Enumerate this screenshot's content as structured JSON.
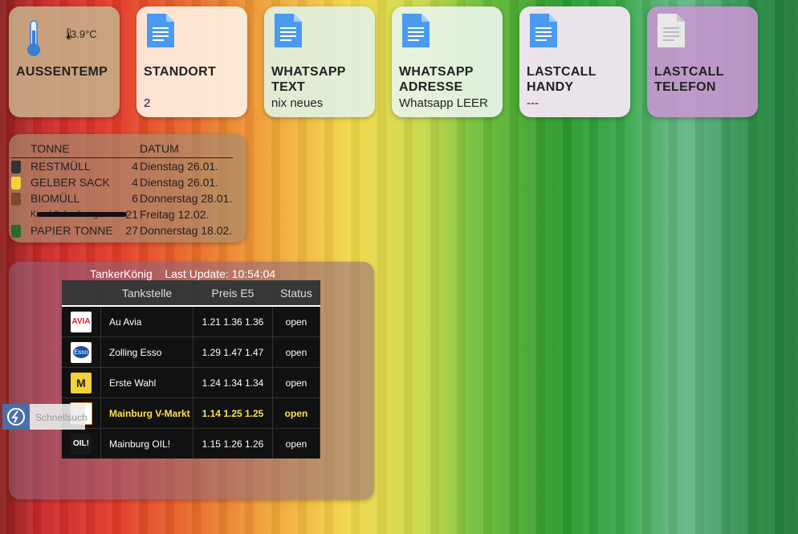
{
  "tiles": [
    {
      "title": "AUSSENTEMP",
      "value": "",
      "temp": "3.9°C",
      "bg": "rgba(200,180,140,0.85)",
      "icon": "thermometer-icon"
    },
    {
      "title": "STANDORT",
      "value": "2",
      "bg": "rgba(255,240,225,0.92)",
      "icon": "document-icon"
    },
    {
      "title": "WHATSAPP TEXT",
      "value": "nix neues",
      "bg": "rgba(225,240,225,0.92)",
      "icon": "document-icon"
    },
    {
      "title": "WHATSAPP ADRESSE",
      "value": "Whatsapp LEER",
      "bg": "rgba(232,244,232,0.92)",
      "icon": "document-icon"
    },
    {
      "title": "LASTCALL HANDY",
      "value": "---",
      "bg": "rgba(250,232,250,0.92)",
      "icon": "document-icon"
    },
    {
      "title": "LASTCALL TELEFON",
      "value": "",
      "bg": "rgba(200,150,210,0.88)",
      "icon": "document-icon-grey"
    }
  ],
  "tonne": {
    "headers": [
      "TONNE",
      "DATUM"
    ],
    "rows": [
      {
        "name": "RESTMÜLL",
        "days": "4",
        "date": "Dienstag 26.01.",
        "color": "#333"
      },
      {
        "name": "GELBER SACK",
        "days": "4",
        "date": "Dienstag 26.01.",
        "color": "#f2d23a"
      },
      {
        "name": "BIOMÜLL",
        "days": "6",
        "date": "Donnerstag 28.01.",
        "color": "#7a4a2a"
      },
      {
        "name": "KrankSchreibung",
        "days": "21",
        "date": "Freitag 12.02.",
        "color": ""
      },
      {
        "name": "PAPIER TONNE",
        "days": "27",
        "date": "Donnerstag 18.02.",
        "color": "#2a6a2a"
      }
    ]
  },
  "tanker": {
    "title": "TankerKönig",
    "update_label": "Last Update: 10:54:04",
    "headers": [
      "",
      "Tankstelle",
      "Preis E5",
      "Status"
    ],
    "rows": [
      {
        "name": "Au Avia",
        "prices": "1.21 1.36 1.36",
        "status": "open",
        "logo": "avia-logo",
        "highlight": false
      },
      {
        "name": "Zolling Esso",
        "prices": "1.29 1.47 1.47",
        "status": "open",
        "logo": "esso-logo",
        "highlight": false
      },
      {
        "name": "Erste Wahl",
        "prices": "1.24 1.34 1.34",
        "status": "open",
        "logo": "erstewahl-logo",
        "highlight": false
      },
      {
        "name": "Mainburg V-Markt",
        "prices": "1.14 1.25 1.25",
        "status": "open",
        "logo": "vmarkt-logo",
        "highlight": true
      },
      {
        "name": "Mainburg OIL!",
        "prices": "1.15 1.26 1.26",
        "status": "open",
        "logo": "oil-logo",
        "highlight": false
      }
    ]
  },
  "quicksearch": {
    "label": "Schnellsuch"
  }
}
